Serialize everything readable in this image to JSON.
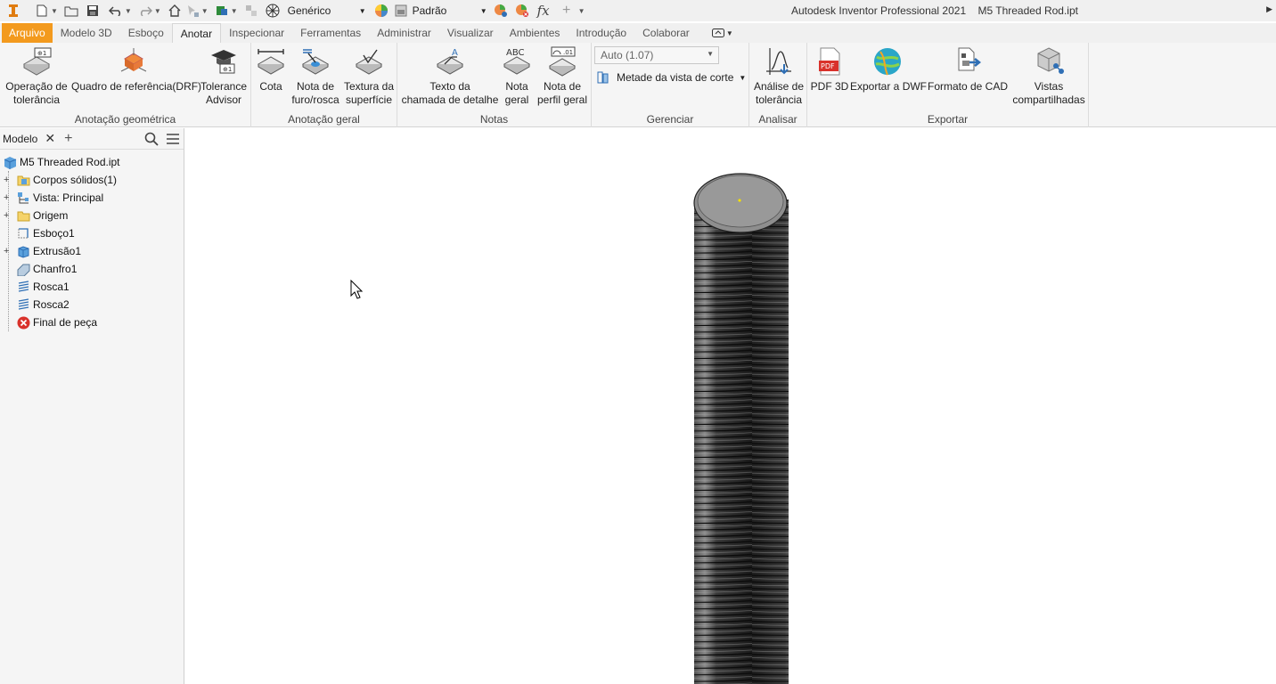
{
  "qat": {
    "material": "Genérico",
    "appearance": "Padrão",
    "fx_label": "fx",
    "title": "Autodesk Inventor Professional 2021",
    "document": "M5 Threaded Rod.ipt"
  },
  "tabs": [
    {
      "label": "Arquivo"
    },
    {
      "label": "Modelo 3D"
    },
    {
      "label": "Esboço"
    },
    {
      "label": "Anotar"
    },
    {
      "label": "Inspecionar"
    },
    {
      "label": "Ferramentas"
    },
    {
      "label": "Administrar"
    },
    {
      "label": "Visualizar"
    },
    {
      "label": "Ambientes"
    },
    {
      "label": "Introdução"
    },
    {
      "label": "Colaborar"
    }
  ],
  "ribbon": {
    "geo": {
      "title": "Anotação geométrica",
      "tol_op": [
        "Operação de",
        "tolerância"
      ],
      "drf": "Quadro de referência(DRF)",
      "advisor": [
        "Tolerance",
        "Advisor"
      ]
    },
    "general": {
      "title": "Anotação geral",
      "cota": "Cota",
      "hole": [
        "Nota de",
        "furo/rosca"
      ],
      "texture": [
        "Textura da",
        "superfície"
      ]
    },
    "notes": {
      "title": "Notas",
      "leader": [
        "Texto da",
        "chamada de detalhe"
      ],
      "general_note": [
        "Nota",
        "geral"
      ],
      "profile_note": [
        "Nota de",
        "perfil geral"
      ],
      "abc": "ABC"
    },
    "manage": {
      "title": "Gerenciar",
      "auto": "Auto (1.07)",
      "section": "Metade da vista de corte"
    },
    "analyze": {
      "title": "Analisar",
      "tol_analysis": [
        "Análise de",
        "tolerância"
      ]
    },
    "export": {
      "title": "Exportar",
      "pdf3d": "PDF 3D",
      "pdf_badge": "PDF",
      "dwf": "Exportar a DWF",
      "cad": "Formato de CAD",
      "shared": [
        "Vistas",
        "compartilhadas"
      ]
    }
  },
  "browser": {
    "tab": "Modelo",
    "root": "M5 Threaded Rod.ipt",
    "nodes": [
      {
        "label": "Corpos sólidos(1)"
      },
      {
        "label": "Vista: Principal"
      },
      {
        "label": "Origem"
      },
      {
        "label": "Esboço1"
      },
      {
        "label": "Extrusão1"
      },
      {
        "label": "Chanfro1"
      },
      {
        "label": "Rosca1"
      },
      {
        "label": "Rosca2"
      },
      {
        "label": "Final de peça"
      }
    ]
  },
  "colors": {
    "file_tab": "#f39a1e",
    "ribbon_bg": "#f5f5f5",
    "rod_dark": "#2a2a2a",
    "rod_light": "#9a9a9a",
    "end_of_part": "#d9322b"
  }
}
